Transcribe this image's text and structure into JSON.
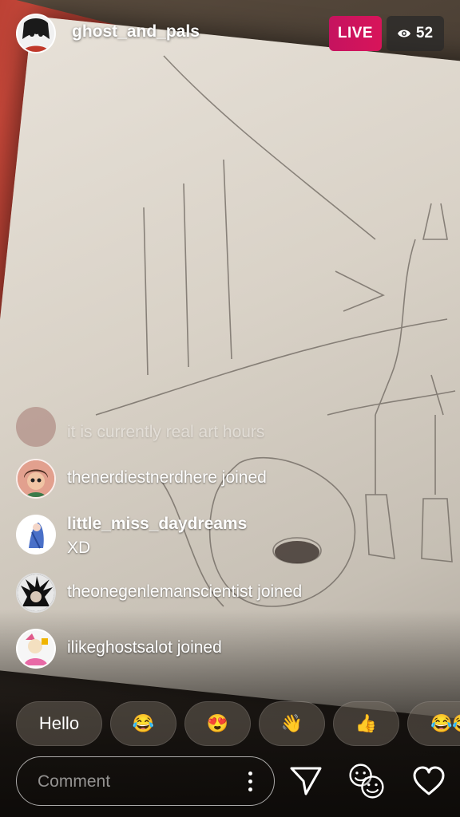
{
  "host": {
    "username": "ghost_and_pals",
    "avatar_icon": "host-avatar-icon"
  },
  "badges": {
    "live_label": "LIVE",
    "live_color": "#d01462",
    "viewer_icon": "eye-icon",
    "viewer_count": "52"
  },
  "comments": {
    "faded": {
      "text": "it is currently real art hours"
    },
    "items": [
      {
        "type": "join",
        "text": "thenerdiestnerdhere joined"
      },
      {
        "type": "message",
        "username": "little_miss_daydreams",
        "message": "XD"
      },
      {
        "type": "join",
        "text": "theonegenlemanscientist joined"
      },
      {
        "type": "join",
        "text": "ilikeghostsalot joined"
      }
    ]
  },
  "quick_replies": {
    "items": [
      {
        "label": "Hello"
      },
      {
        "label": "😂"
      },
      {
        "label": "😍"
      },
      {
        "label": "👋"
      },
      {
        "label": "👍"
      },
      {
        "label": "😂😂"
      }
    ]
  },
  "footer": {
    "comment_placeholder": "Comment",
    "more_icon": "more-vertical-icon",
    "send_icon": "send-icon",
    "faces_icon": "faces-icon",
    "like_icon": "heart-icon"
  }
}
